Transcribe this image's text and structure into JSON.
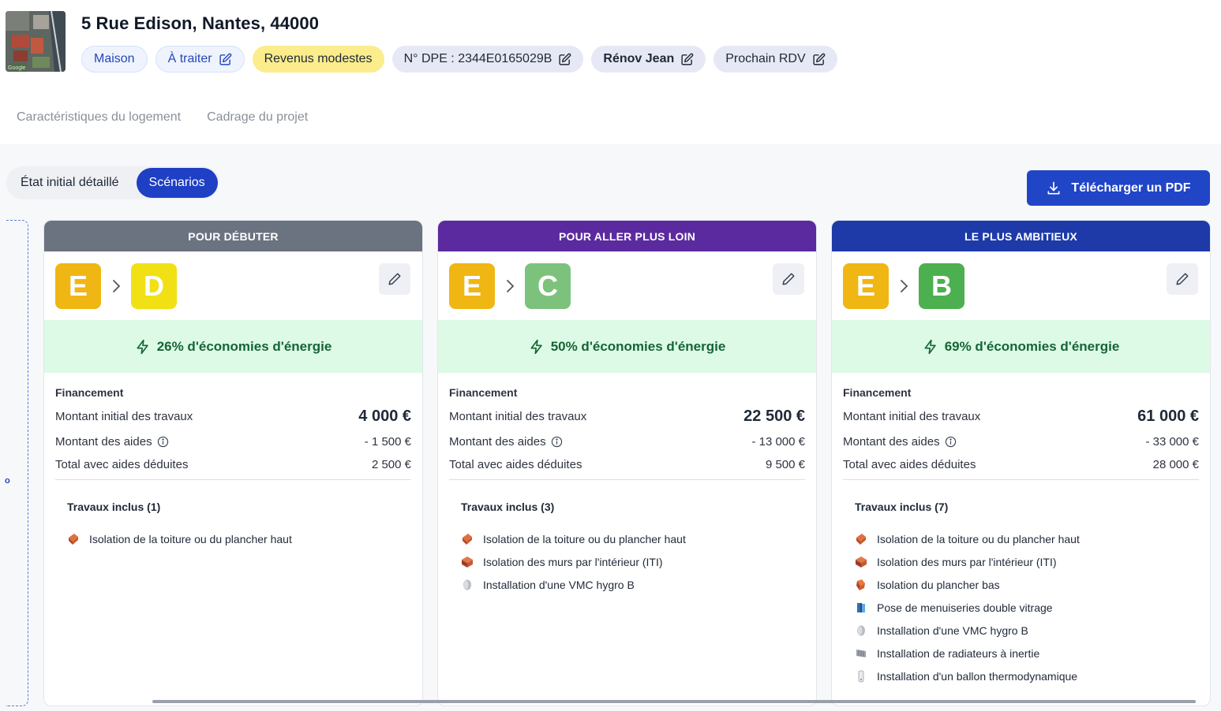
{
  "header": {
    "address": "5 Rue Edison, Nantes, 44000",
    "thumbnail_label": "Google",
    "chips": [
      {
        "label": "Maison",
        "style": "blue",
        "editable": false
      },
      {
        "label": "À traiter",
        "style": "blue",
        "editable": true
      },
      {
        "label": "Revenus modestes",
        "style": "yellow",
        "editable": false
      },
      {
        "label": "N° DPE : 2344E0165029B",
        "style": "gray",
        "editable": true
      },
      {
        "label": "Rénov Jean",
        "style": "gray",
        "editable": true,
        "bold": true
      },
      {
        "label": "Prochain RDV",
        "style": "gray",
        "editable": true
      }
    ]
  },
  "page_tabs": [
    "Caractéristiques du logement",
    "Cadrage du projet"
  ],
  "view_toggle": {
    "options": [
      "État initial détaillé",
      "Scénarios"
    ],
    "selected": "Scénarios"
  },
  "download_button": "Télécharger un PDF",
  "side_marker": "o",
  "scenarios": [
    {
      "header": "POUR DÉBUTER",
      "header_color": "#6b7280",
      "from_class": "E",
      "to_class": "D",
      "to_color": "#f1e014",
      "savings": "26% d'économies d'énergie",
      "financing_title": "Financement",
      "initial_label": "Montant initial des travaux",
      "initial_value": "4 000 €",
      "aid_label": "Montant des aides",
      "aid_value": "- 1 500 €",
      "total_label": "Total avec aides déduites",
      "total_value": "2 500 €",
      "works_title": "Travaux inclus (1)",
      "works": [
        {
          "label": "Isolation de la toiture ou du plancher haut",
          "icon": "roof-insulation-icon"
        }
      ]
    },
    {
      "header": "POUR ALLER PLUS LOIN",
      "header_color": "#5b2a9e",
      "from_class": "E",
      "to_class": "C",
      "to_color": "#7cc27c",
      "savings": "50% d'économies d'énergie",
      "financing_title": "Financement",
      "initial_label": "Montant initial des travaux",
      "initial_value": "22 500 €",
      "aid_label": "Montant des aides",
      "aid_value": "- 13 000 €",
      "total_label": "Total avec aides déduites",
      "total_value": "9 500 €",
      "works_title": "Travaux inclus (3)",
      "works": [
        {
          "label": "Isolation de la toiture ou du plancher haut",
          "icon": "roof-insulation-icon"
        },
        {
          "label": "Isolation des murs par l'intérieur (ITI)",
          "icon": "wall-insulation-icon"
        },
        {
          "label": "Installation d'une VMC hygro B",
          "icon": "vmc-icon"
        }
      ]
    },
    {
      "header": "LE PLUS AMBITIEUX",
      "header_color": "#1e3aa8",
      "from_class": "E",
      "to_class": "B",
      "to_color": "#4caf50",
      "savings": "69% d'économies d'énergie",
      "financing_title": "Financement",
      "initial_label": "Montant initial des travaux",
      "initial_value": "61 000 €",
      "aid_label": "Montant des aides",
      "aid_value": "- 33 000 €",
      "total_label": "Total avec aides déduites",
      "total_value": "28 000 €",
      "works_title": "Travaux inclus (7)",
      "works": [
        {
          "label": "Isolation de la toiture ou du plancher haut",
          "icon": "roof-insulation-icon"
        },
        {
          "label": "Isolation des murs par l'intérieur (ITI)",
          "icon": "wall-insulation-icon"
        },
        {
          "label": "Isolation du plancher bas",
          "icon": "floor-insulation-icon"
        },
        {
          "label": "Pose de menuiseries double vitrage",
          "icon": "window-icon"
        },
        {
          "label": "Installation d'une VMC hygro B",
          "icon": "vmc-icon"
        },
        {
          "label": "Installation de radiateurs à inertie",
          "icon": "radiator-icon"
        },
        {
          "label": "Installation d'un ballon thermodynamique",
          "icon": "water-heater-icon"
        }
      ]
    }
  ]
}
